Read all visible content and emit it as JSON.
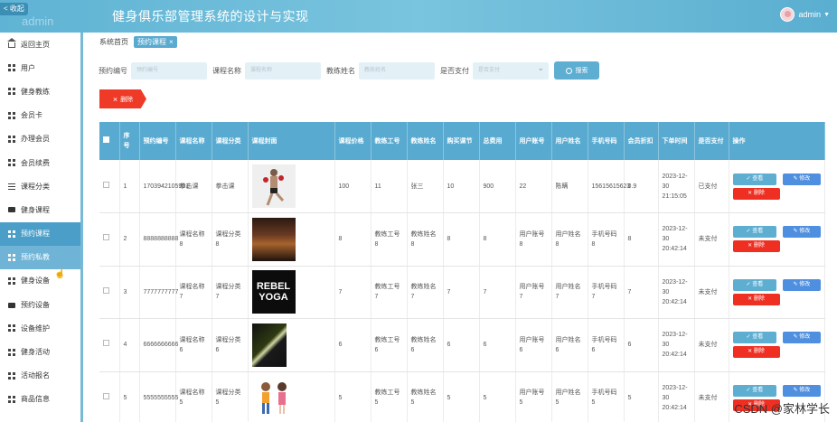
{
  "header": {
    "back_label": "< 收起",
    "ghost_label": "admin",
    "title": "健身俱乐部管理系统的设计与实现",
    "user_name": "admin"
  },
  "sidebar": {
    "items": [
      {
        "label": "返回主页",
        "icon": "home-icon"
      },
      {
        "label": "用户",
        "icon": "grid-icon"
      },
      {
        "label": "健身教练",
        "icon": "grid-icon"
      },
      {
        "label": "会员卡",
        "icon": "grid-icon"
      },
      {
        "label": "办理会员",
        "icon": "grid-icon"
      },
      {
        "label": "会员续费",
        "icon": "grid-icon"
      },
      {
        "label": "课程分类",
        "icon": "lines-icon"
      },
      {
        "label": "健身课程",
        "icon": "film-icon"
      },
      {
        "label": "预约课程",
        "icon": "grid-icon"
      },
      {
        "label": "预约私教",
        "icon": "grid-icon"
      },
      {
        "label": "健身设备",
        "icon": "grid-icon"
      },
      {
        "label": "预约设备",
        "icon": "bag-icon"
      },
      {
        "label": "设备维护",
        "icon": "grid-icon"
      },
      {
        "label": "健身活动",
        "icon": "grid-icon"
      },
      {
        "label": "活动报名",
        "icon": "grid-icon"
      },
      {
        "label": "商品信息",
        "icon": "grid-icon"
      }
    ]
  },
  "breadcrumb": {
    "home": "系统首页",
    "current": "预约课程"
  },
  "search": {
    "fields": [
      {
        "label": "预约编号",
        "placeholder": "预约编号"
      },
      {
        "label": "课程名称",
        "placeholder": "课程名称"
      },
      {
        "label": "教练姓名",
        "placeholder": "教练姓名"
      }
    ],
    "paid_label": "是否支付",
    "paid_placeholder": "是否支付",
    "button": "搜索"
  },
  "delete_button": "删除",
  "table": {
    "headers": [
      "序号",
      "预约编号",
      "课程名称",
      "课程分类",
      "课程封面",
      "课程价格",
      "教练工号",
      "教练姓名",
      "购买课节",
      "总费用",
      "用户账号",
      "用户姓名",
      "手机号码",
      "会员折扣",
      "下单时间",
      "是否支付",
      "操作"
    ],
    "rows": [
      {
        "no": "1",
        "code": "1703942105901",
        "course": "拳击课",
        "category": "拳击课",
        "price": "100",
        "coach_no": "11",
        "coach_name": "张三",
        "sessions": "10",
        "total": "900",
        "account": "22",
        "user_name": "陈瞒",
        "phone": "15615615623",
        "discount": "0.9",
        "time": "2023-12-30 21:15:05",
        "paid": "已支付"
      },
      {
        "no": "2",
        "code": "8888888888",
        "course": "课程名称8",
        "category": "课程分类8",
        "price": "8",
        "coach_no": "教练工号8",
        "coach_name": "教练姓名8",
        "sessions": "8",
        "total": "8",
        "account": "用户账号8",
        "user_name": "用户姓名8",
        "phone": "手机号码8",
        "discount": "8",
        "time": "2023-12-30 20:42:14",
        "paid": "未支付"
      },
      {
        "no": "3",
        "code": "7777777777",
        "course": "课程名称7",
        "category": "课程分类7",
        "price": "7",
        "coach_no": "教练工号7",
        "coach_name": "教练姓名7",
        "sessions": "7",
        "total": "7",
        "account": "用户账号7",
        "user_name": "用户姓名7",
        "phone": "手机号码7",
        "discount": "7",
        "time": "2023-12-30 20:42:14",
        "paid": "未支付"
      },
      {
        "no": "4",
        "code": "6666666666",
        "course": "课程名称6",
        "category": "课程分类6",
        "price": "6",
        "coach_no": "教练工号6",
        "coach_name": "教练姓名6",
        "sessions": "6",
        "total": "6",
        "account": "用户账号6",
        "user_name": "用户姓名6",
        "phone": "手机号码6",
        "discount": "6",
        "time": "2023-12-30 20:42:14",
        "paid": "未支付"
      },
      {
        "no": "5",
        "code": "5555555555",
        "course": "课程名称5",
        "category": "课程分类5",
        "price": "5",
        "coach_no": "教练工号5",
        "coach_name": "教练姓名5",
        "sessions": "5",
        "total": "5",
        "account": "用户账号5",
        "user_name": "用户姓名5",
        "phone": "手机号码5",
        "discount": "5",
        "time": "2023-12-30 20:42:14",
        "paid": "未支付"
      }
    ],
    "cover_texts": {
      "row3": "REBEL YOGA"
    },
    "actions": {
      "view": "查看",
      "edit": "修改",
      "delete": "删除"
    }
  },
  "watermark": "CSDN @家林学长",
  "colors": {
    "primary": "#58aad0",
    "danger": "#ee3a27",
    "edit": "#4f8fe0"
  }
}
